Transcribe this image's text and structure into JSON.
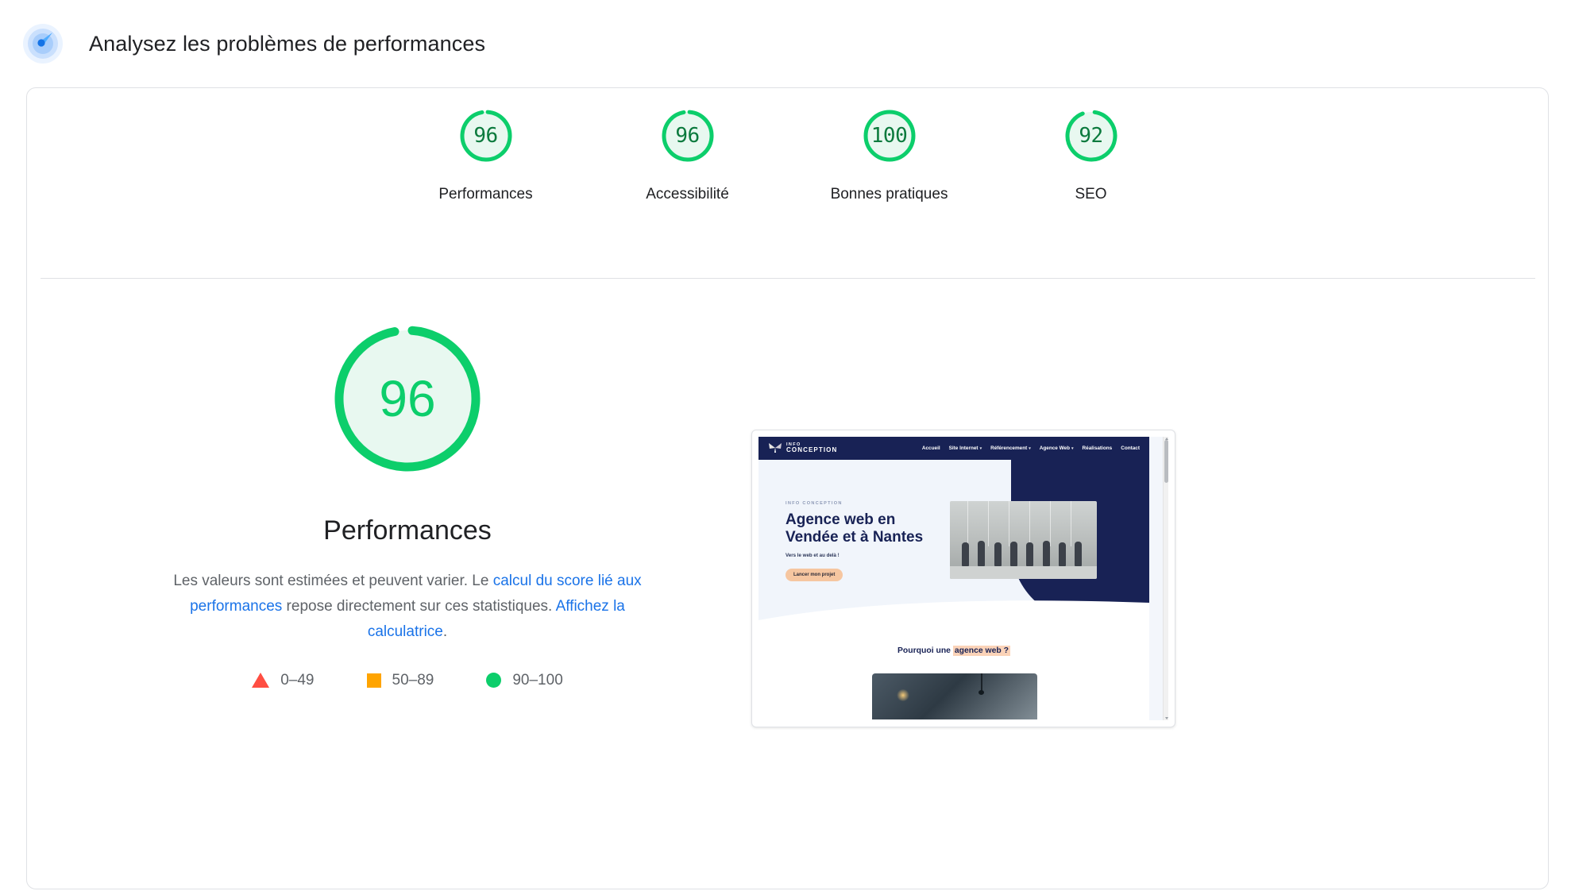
{
  "header": {
    "icon": "lighthouse-icon",
    "title": "Analysez les problèmes de performances"
  },
  "colors": {
    "pass": "#0cce6b",
    "pass_text": "#0b7a3d",
    "pass_fill": "#e8f8f0",
    "average": "#ffa400",
    "fail": "#ff4e42",
    "link": "#1a73e8",
    "body_text": "#5f6368",
    "title_text": "#202124",
    "site_navy": "#182255",
    "site_accent": "#f6c6a0"
  },
  "scores": {
    "summary": [
      {
        "label": "Performances",
        "value": 96,
        "display": "96",
        "status": "pass"
      },
      {
        "label": "Accessibilité",
        "value": 96,
        "display": "96",
        "status": "pass"
      },
      {
        "label": "Bonnes pratiques",
        "value": 100,
        "display": "100",
        "status": "pass"
      },
      {
        "label": "SEO",
        "value": 92,
        "display": "92",
        "status": "pass"
      }
    ]
  },
  "detail": {
    "score_display": "96",
    "score_value": 96,
    "category_title": "Performances",
    "description": {
      "part1": "Les valeurs sont estimées et peuvent varier. Le ",
      "link1": "calcul du score lié aux performances",
      "part2": " repose directement sur ces statistiques. ",
      "link2": "Affichez la calculatrice",
      "part3": "."
    },
    "legend": [
      {
        "shape": "triangle",
        "color": "#ff4e42",
        "range": "0–49"
      },
      {
        "shape": "square",
        "color": "#ffa400",
        "range": "50–89"
      },
      {
        "shape": "circle",
        "color": "#0cce6b",
        "range": "90–100"
      }
    ]
  },
  "screenshot": {
    "alt": "final-screenshot",
    "site": {
      "logo_line1": "INFO",
      "logo_line2": "CONCEPTION",
      "nav": [
        {
          "label": "Accueil",
          "has_caret": false
        },
        {
          "label": "Site Internet",
          "has_caret": true
        },
        {
          "label": "Référencement",
          "has_caret": true
        },
        {
          "label": "Agence Web",
          "has_caret": true
        },
        {
          "label": "Réalisations",
          "has_caret": false
        },
        {
          "label": "Contact",
          "has_caret": false
        }
      ],
      "hero": {
        "eyebrow": "INFO CONCEPTION",
        "title_line1": "Agence web en",
        "title_line2": "Vendée et à Nantes",
        "subtitle": "Vers le web et au delà !",
        "cta": "Lancer mon projet"
      },
      "section": {
        "title_prefix": "Pourquoi une ",
        "title_highlight": "agence web ?"
      }
    }
  }
}
